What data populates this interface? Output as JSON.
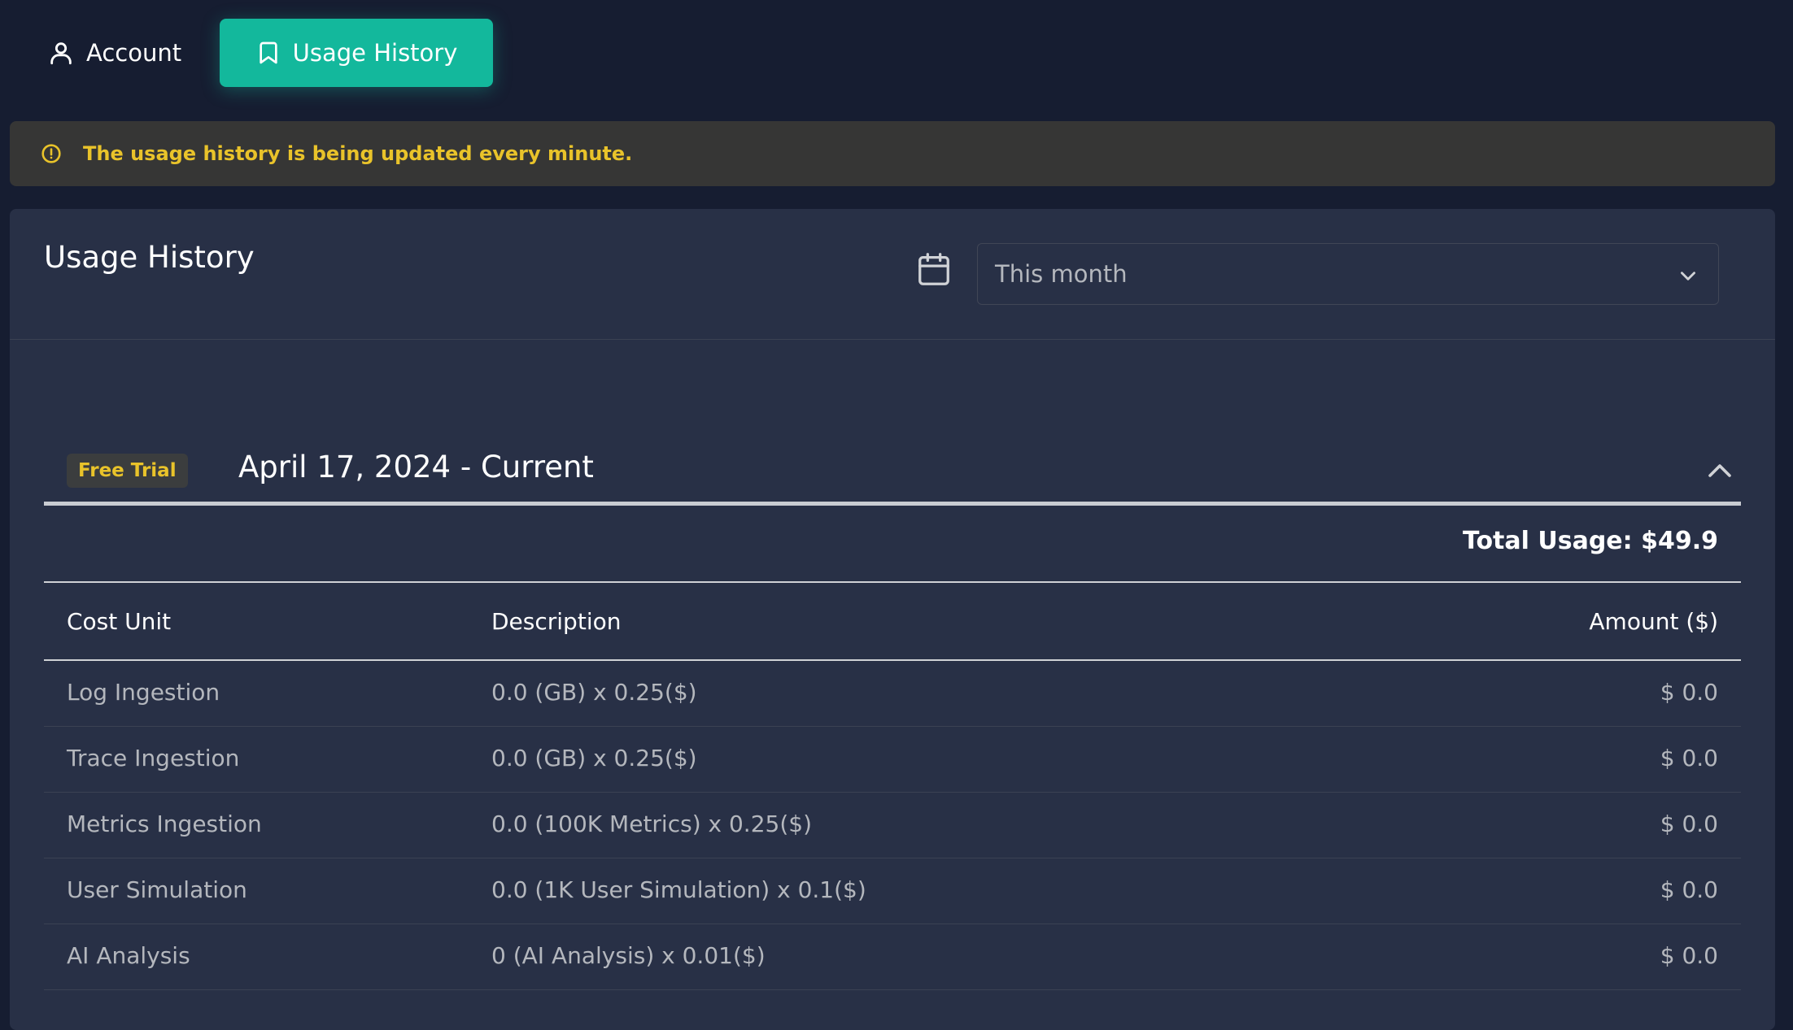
{
  "tabs": [
    {
      "label": "Account",
      "icon": "user-icon",
      "active": false
    },
    {
      "label": "Usage History",
      "icon": "bookmark-icon",
      "active": true
    }
  ],
  "alert": {
    "icon": "info-circle-icon",
    "text": "The usage history is being updated every minute.",
    "color": "#e9c32a"
  },
  "card": {
    "title": "Usage History",
    "period_select": {
      "value": "This month",
      "icon": "calendar-icon"
    }
  },
  "section": {
    "badge": "Free Trial",
    "period": "April 17, 2024 - Current",
    "total": "Total Usage: $49.9"
  },
  "table": {
    "headers": [
      "Cost Unit",
      "Description",
      "Amount ($)"
    ],
    "rows": [
      [
        "Log Ingestion",
        "0.0 (GB) x 0.25($)",
        "$ 0.0"
      ],
      [
        "Trace Ingestion",
        "0.0 (GB) x 0.25($)",
        "$ 0.0"
      ],
      [
        "Metrics Ingestion",
        "0.0 (100K Metrics) x 0.25($)",
        "$ 0.0"
      ],
      [
        "User Simulation",
        "0.0 (1K User Simulation) x 0.1($)",
        "$ 0.0"
      ],
      [
        "AI Analysis",
        "0 (AI Analysis) x 0.01($)",
        "$ 0.0"
      ]
    ]
  },
  "colors": {
    "accent": "#13b89c",
    "background": "#161d31",
    "card": "#283046",
    "warning": "#e9c32a"
  }
}
